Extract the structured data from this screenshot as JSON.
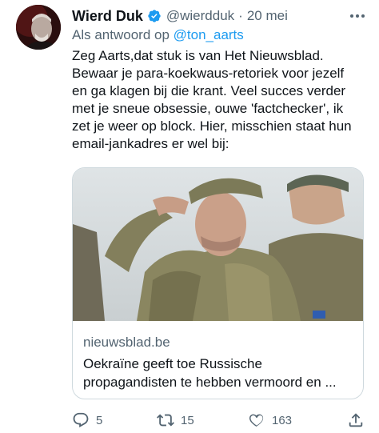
{
  "tweet": {
    "display_name": "Wierd Duk",
    "handle": "@wierdduk",
    "separator": "·",
    "date": "20 mei",
    "reply_prefix": "Als antwoord op",
    "reply_to": "@ton_aarts",
    "body_lines": [
      "Zeg Aarts,dat stuk is van Het Nieuwsblad.",
      "Bewaar je para-koekwaus-retoriek voor jezelf",
      "en ga klagen bij die krant. Veel succes verder",
      "met je sneue obsessie, ouwe 'factchecker', ik",
      "zet je weer op block.  Hier, misschien staat hun",
      "email-jankadres er wel bij:"
    ]
  },
  "card": {
    "domain": "nieuwsblad.be",
    "title_lines": [
      "Oekraïne geeft toe Russische",
      "propagandisten te hebben vermoord en ..."
    ]
  },
  "actions": {
    "replies": "5",
    "retweets": "15",
    "likes": "163"
  },
  "colors": {
    "accent": "#1d9bf0",
    "text": "#0f1419",
    "secondary": "#536471",
    "border": "#cfd9de"
  },
  "icons": [
    "verified-badge-icon",
    "more-options-icon",
    "reply-icon",
    "retweet-icon",
    "like-icon",
    "share-icon"
  ]
}
